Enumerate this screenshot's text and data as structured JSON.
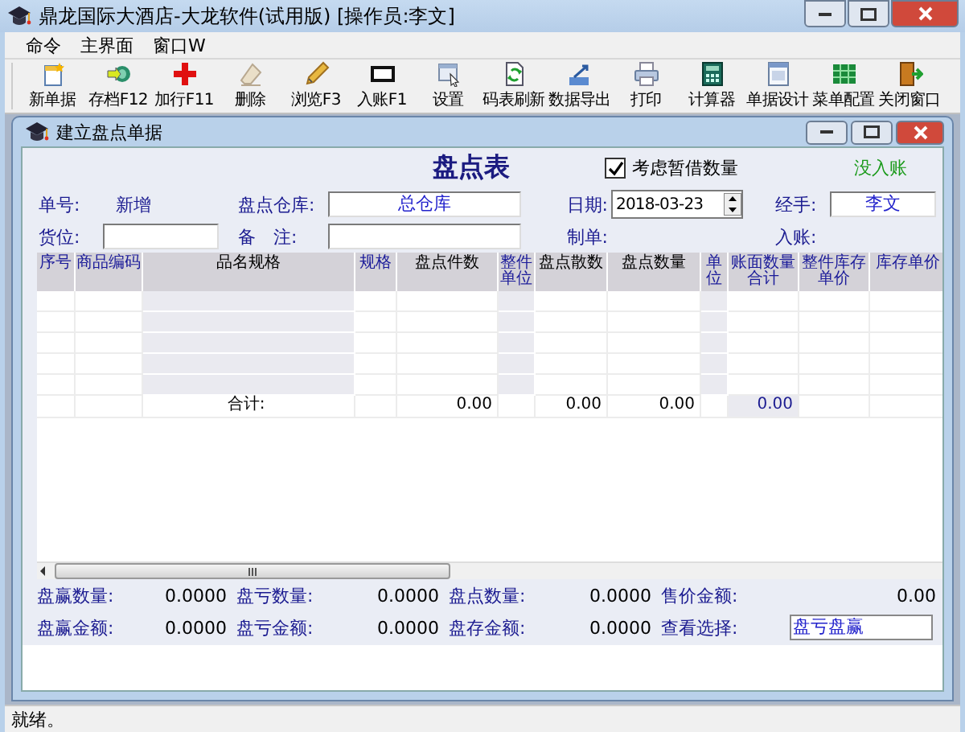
{
  "window": {
    "title": "鼎龙国际大酒店-大龙软件(试用版) [操作员:李文]"
  },
  "menu": [
    "命令",
    "主界面",
    "窗口W"
  ],
  "toolbar": [
    {
      "label": "新单据"
    },
    {
      "label": "存档F12"
    },
    {
      "label": "加行F11"
    },
    {
      "label": "删除"
    },
    {
      "label": "浏览F3"
    },
    {
      "label": "入账F1"
    },
    {
      "label": "设置"
    },
    {
      "label": "码表刷新"
    },
    {
      "label": "数据导出"
    },
    {
      "label": "打印"
    },
    {
      "label": "计算器"
    },
    {
      "label": "单据设计"
    },
    {
      "label": "菜单配置"
    },
    {
      "label": "关闭窗口"
    }
  ],
  "child_window": {
    "title": "建立盘点单据"
  },
  "form": {
    "heading": "盘点表",
    "consider_borrowed": {
      "label": "考虑暂借数量",
      "checked": true
    },
    "posting_status": "没入账",
    "doc_no": {
      "label": "单号:",
      "value": "新增"
    },
    "warehouse": {
      "label": "盘点仓库:",
      "value": "总仓库"
    },
    "date": {
      "label": "日期:",
      "value": "2018-03-23"
    },
    "handler": {
      "label": "经手:",
      "value": "李文"
    },
    "location": {
      "label": "货位:"
    },
    "remark": {
      "label": "备　注:"
    },
    "maker": {
      "label": "制单:"
    },
    "posted": {
      "label": "入账:"
    }
  },
  "grid": {
    "columns": [
      {
        "label": "序号",
        "color": "#1a1a99",
        "shaded": false
      },
      {
        "label": "商品编码",
        "color": "#1a1a99",
        "shaded": false
      },
      {
        "label": "品名规格",
        "color": "#000000",
        "shaded": true,
        "total": "合计:"
      },
      {
        "label": "规格",
        "color": "#1a1a99",
        "shaded": false
      },
      {
        "label": "盘点件数",
        "color": "#000000",
        "shaded": false,
        "total": "0.00"
      },
      {
        "label": "整件单位",
        "color": "#1a1a99",
        "shaded": true
      },
      {
        "label": "盘点散数",
        "color": "#000000",
        "shaded": false,
        "total": "0.00"
      },
      {
        "label": "盘点数量",
        "color": "#000000",
        "shaded": false,
        "total": "0.00"
      },
      {
        "label": "单位",
        "color": "#1a1a99",
        "shaded": true
      },
      {
        "label": "账面数量合计",
        "color": "#1a1a99",
        "shaded": false,
        "total": "0.00"
      },
      {
        "label": "整件库存单价",
        "color": "#1a1a99",
        "shaded": false
      },
      {
        "label": "库存单价",
        "color": "#1a1a99",
        "shaded": false
      }
    ]
  },
  "summary": [
    {
      "label": "盘赢数量:",
      "value": "0.0000",
      "kind": "reading"
    },
    {
      "label": "盘亏数量:",
      "value": "0.0000",
      "kind": "reading"
    },
    {
      "label": "盘点数量:",
      "value": "0.0000",
      "kind": "reading"
    },
    {
      "label": "售价金额:",
      "value": "0.00",
      "kind": "reading"
    },
    {
      "label": "盘赢金额:",
      "value": "0.0000",
      "kind": "reading"
    },
    {
      "label": "盘亏金额:",
      "value": "0.0000",
      "kind": "reading"
    },
    {
      "label": "盘存金额:",
      "value": "0.0000",
      "kind": "reading"
    },
    {
      "label": "查看选择:",
      "value": "盘亏盘赢",
      "kind": "select"
    }
  ],
  "status_bar": "就绪。"
}
